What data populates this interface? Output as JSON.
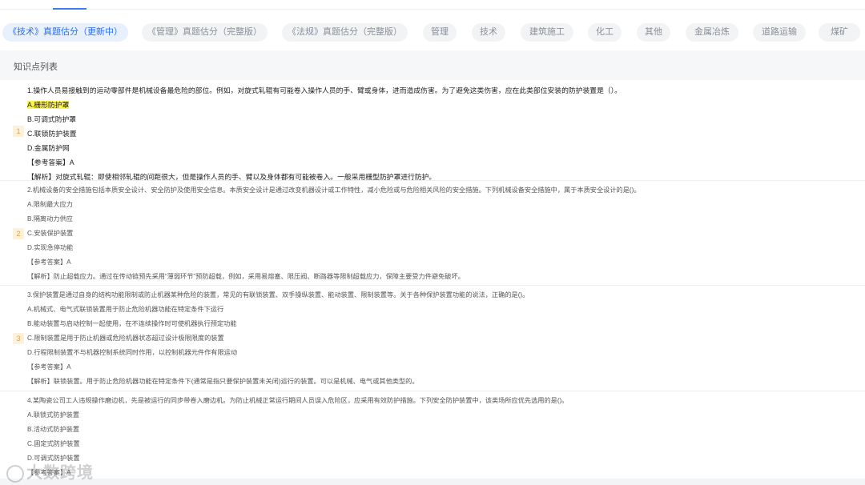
{
  "tabs": [
    {
      "label": "《技术》真题估分（更新中）",
      "active": true
    },
    {
      "label": "《管理》真题估分（完整版）",
      "active": false
    },
    {
      "label": "《法规》真题估分（完整版）",
      "active": false
    },
    {
      "label": "管理",
      "active": false
    },
    {
      "label": "技术",
      "active": false
    },
    {
      "label": "建筑施工",
      "active": false
    },
    {
      "label": "化工",
      "active": false
    },
    {
      "label": "其他",
      "active": false
    },
    {
      "label": "金属冶炼",
      "active": false
    },
    {
      "label": "道路运输",
      "active": false
    },
    {
      "label": "煤矿",
      "active": false
    }
  ],
  "section": {
    "title": "知识点列表"
  },
  "questions": [
    {
      "number": "1",
      "stem": "1.操作人员易接触到的运动零部件是机械设备最危险的部位。例如，对旋式轧辊有可能卷入操作人员的手、臂或身体，进而造成伤害。为了避免这类伤害，应在此类部位安装的防护装置是（）。",
      "options": [
        "A.栅形防护罩",
        "B.可调式防护罩",
        "C.联锁防护装置",
        "D.金属防护网"
      ],
      "answer": "【参考答案】A",
      "analysis": "【解析】对旋式轧辊：即使相邻轧辊的间距很大，但是操作人员的手、臂以及身体都有可能被卷入。一般采用栅型防护罩进行防护。"
    },
    {
      "number": "2",
      "stem": "2.机械设备的安全措施包括本质安全设计、安全防护及使用安全信息。本质安全设计是通过改变机器设计或工作特性，减小危险或与危险相关风险的安全措施。下列机械设备安全措施中，属于本质安全设计的是()。",
      "options": [
        "A.限制最大应力",
        "B.隔离动力供应",
        "C.安装保护装置",
        "D.实现急停功能"
      ],
      "answer": "【参考答案】A",
      "analysis": "【解析】防止超载应力。通过在传动链预先采用“薄弱环节”预防超载，例如，采用易熔塞、限压阀、断路器等限制超载应力，保障主要受力件避免破坏。"
    },
    {
      "number": "3",
      "stem": "3.保护装置是通过自身的结构功能限制或防止机器某种危险的装置，常见的有联锁装置、双手操纵装置、能动装置、限制装置等。关于各种保护装置功能的说法，正确的是()。",
      "options": [
        "A.机械式、电气式联锁装置用于防止危险机器功能在特定条件下运行",
        "B.能动装置与启动控制一起使用，在不连续操作时可使机器执行预定功能",
        "C.限制装置是用于防止机器或危险机器状态超过设计极限限度的装置",
        "D.行程限制装置不与机器控制系统同时作用，以控制机器元件作有限运动"
      ],
      "answer": "【参考答案】A",
      "analysis": "【解析】联锁装置。用于防止危险机器功能在特定条件下(通常是指只要保护装置未关闭)运行的装置。可以是机械、电气或其他类型的。"
    },
    {
      "number": "4",
      "stem": "4.某陶瓷公司工人违规操作磨边机，先是被运行的同步带卷入磨边机。为防止机械正常运行期间人员误入危险区，应采用有效防护措施。下列安全防护装置中，该类场所应优先选用的是()。",
      "options": [
        "A.联锁式防护装置",
        "B.活动式防护装置",
        "C.固定式防护装置",
        "D.可调式防护装置"
      ],
      "answer": "【参考答案】A"
    }
  ],
  "watermark": {
    "text": "大数跨境"
  }
}
